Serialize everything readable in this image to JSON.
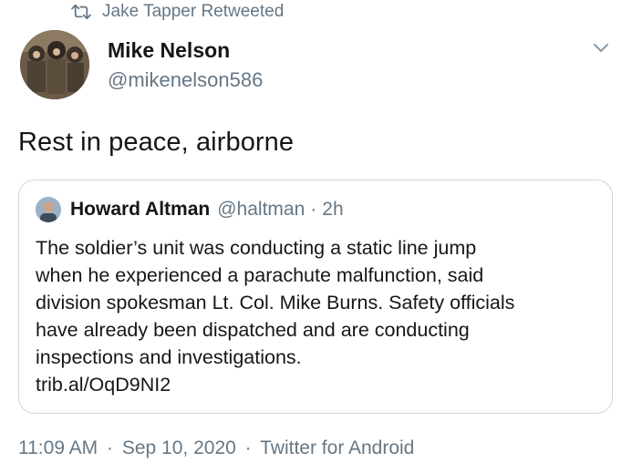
{
  "retweet": {
    "label": "Jake Tapper Retweeted",
    "icon": "retweet-icon"
  },
  "author": {
    "name": "Mike Nelson",
    "handle": "@mikenelson586"
  },
  "tweet": {
    "text": "Rest in peace, airborne"
  },
  "quoted_tweet": {
    "author_name": "Howard Altman",
    "author_handle": "@haltman",
    "separator": "·",
    "time": "2h",
    "lines": [
      "The soldier’s unit was conducting a static line jump",
      "when he experienced a parachute malfunction, said",
      "division spokesman Lt. Col. Mike Burns. Safety officials",
      "have already been dispatched and are conducting",
      "inspections and investigations.",
      "trib.al/OqD9NI2"
    ]
  },
  "footer": {
    "time": "11:09 AM",
    "separator": "·",
    "date": "Sep 10, 2020",
    "client": "Twitter for Android"
  },
  "colors": {
    "text_primary": "#14171a",
    "text_secondary": "#657786",
    "border": "#ccd6dd"
  }
}
